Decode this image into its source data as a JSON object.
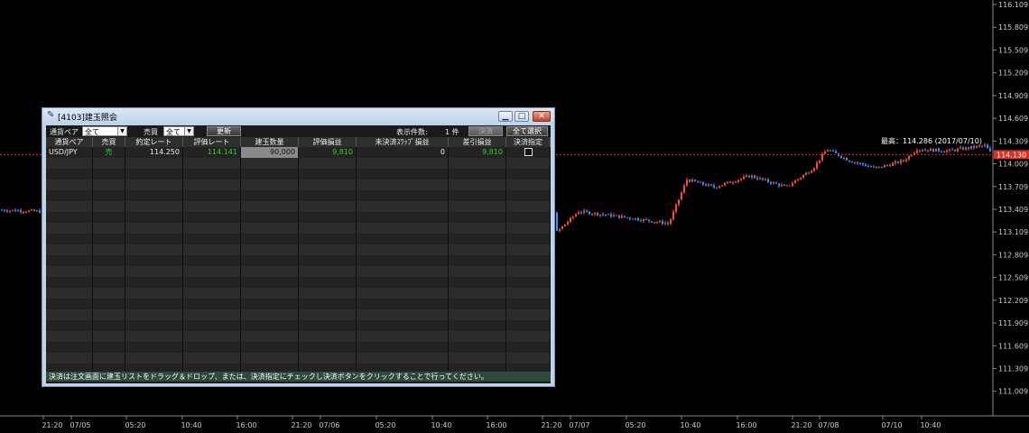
{
  "chart": {
    "price_axis_labels": [
      "116.109",
      "115.809",
      "115.509",
      "115.209",
      "114.909",
      "114.609",
      "114.309",
      "114.009",
      "113.709",
      "113.409",
      "113.109",
      "112.809",
      "112.509",
      "112.209",
      "111.909",
      "111.609",
      "111.309",
      "111.009"
    ],
    "current_price": "114.130",
    "high_annotation": "最高：114.286 (2017/07/10)",
    "time_axis_labels": [
      "21:20",
      "07/05",
      "05:20",
      "10:40",
      "16:00",
      "21:20",
      "07/06",
      "05:20",
      "10:40",
      "16:00",
      "21:20",
      "07/07",
      "05:20",
      "10:40",
      "16:00",
      "21:20",
      "07/08",
      "07/10",
      "10:40"
    ],
    "colors": {
      "up": "#ff4b2b",
      "down": "#3b8cff",
      "grid": "#333333",
      "current_line": "#d93025"
    }
  },
  "window": {
    "title": "[4103]建玉照会",
    "minimize": "▁",
    "maximize": "□",
    "close": "✕",
    "icon": "pen-icon"
  },
  "toolbar": {
    "pair_label": "通貨ペア",
    "pair_value": "全て",
    "side_label": "売買",
    "side_value": "全て",
    "refresh": "更新",
    "count_label": "表示件数:",
    "count_value": "1 件",
    "settle_button": "決済",
    "select_all": "全て選択"
  },
  "table": {
    "headers": [
      "通貨ペア",
      "売買",
      "約定レート",
      "評価レート",
      "建玉数量",
      "評価損益",
      "未決済ｽﾜｯﾌﾟ損益",
      "差引損益",
      "決済指定"
    ],
    "rows": [
      [
        "USD/JPY",
        "売",
        "114.250",
        "114.141",
        "90,000",
        "9,810",
        "0",
        "9,810",
        ""
      ]
    ]
  },
  "footer": {
    "text": "決済は注文画面に建玉リストをドラッグ＆ドロップ、または、決済指定にチェックし決済ボタンをクリックすることで行ってください。"
  }
}
